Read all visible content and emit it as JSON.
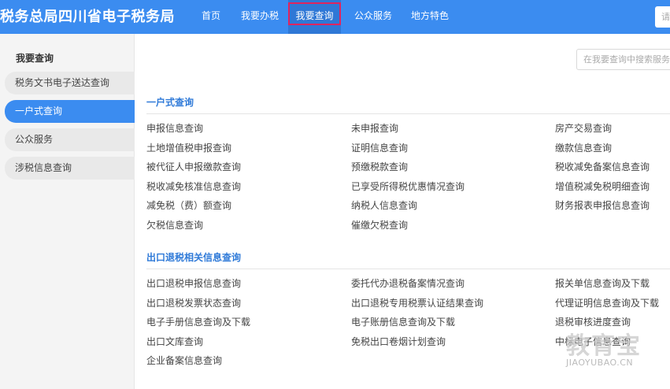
{
  "header": {
    "brand": "税务总局四川省电子税务局",
    "nav": [
      "首页",
      "我要办税",
      "我要查询",
      "公众服务",
      "地方特色"
    ],
    "active_nav": "我要查询",
    "search_placeholder": "请"
  },
  "sidebar": {
    "title": "我要查询",
    "items": [
      {
        "label": "税务文书电子送达查询"
      },
      {
        "label": "一户式查询"
      },
      {
        "label": "公众服务"
      },
      {
        "label": "涉税信息查询"
      }
    ],
    "active_item": "一户式查询"
  },
  "main": {
    "search_placeholder": "在我要查询中搜索服务",
    "sections": [
      {
        "title": "一户式查询",
        "links": [
          "申报信息查询",
          "未申报查询",
          "房产交易查询",
          "土地增值税申报查询",
          "证明信息查询",
          "缴款信息查询",
          "被代征人申报缴款查询",
          "预缴税款查询",
          "税收减免备案信息查询",
          "税收减免核准信息查询",
          "已享受所得税优惠情况查询",
          "增值税减免税明细查询",
          "减免税（费）额查询",
          "纳税人信息查询",
          "财务报表申报信息查询",
          "欠税信息查询",
          "催缴欠税查询"
        ]
      },
      {
        "title": "出口退税相关信息查询",
        "links": [
          "出口退税申报信息查询",
          "委托代办退税备案情况查询",
          "报关单信息查询及下载",
          "出口退税发票状态查询",
          "出口退税专用税票认证结果查询",
          "代理证明信息查询及下载",
          "电子手册信息查询及下载",
          "电子账册信息查询及下载",
          "退税审核进度查询",
          "出口文库查询",
          "免税出口卷烟计划查询",
          "中标电子信息查询",
          "企业备案信息查询"
        ]
      }
    ]
  },
  "watermark": {
    "logo": "教育宝",
    "url": "JIAOYUBAO.CN"
  },
  "colors": {
    "brand_blue": "#3b8cf0",
    "active_nav_bg": "#2f78d6",
    "highlight_border": "#e0245e",
    "section_title": "#2f7ad8"
  }
}
